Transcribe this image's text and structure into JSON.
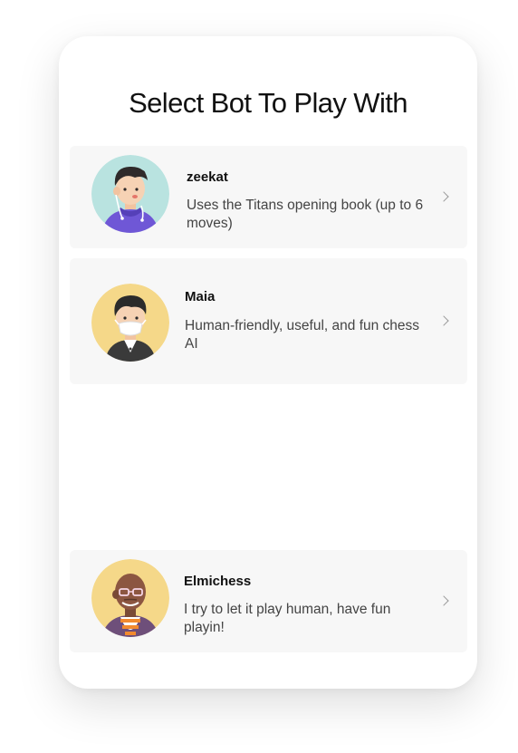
{
  "page": {
    "title": "Select Bot To Play With"
  },
  "bots": [
    {
      "name": "zeekat",
      "description": "Uses the Titans opening book (up to 6 moves)",
      "avatar_color": "#b9e3e0",
      "avatar_icon": "boy-with-earbuds-avatar-icon"
    },
    {
      "name": "Maia",
      "description": "Human-friendly, useful, and fun chess AI",
      "avatar_color": "#f5d889",
      "avatar_icon": "boy-with-face-mask-avatar-icon"
    },
    {
      "name": "Elmichess",
      "description": "I try to let it play human, have fun playin!",
      "avatar_color": "#f5d889",
      "avatar_icon": "bald-man-with-glasses-avatar-icon"
    }
  ],
  "icons": {
    "chevron": "chevron-right-icon"
  }
}
